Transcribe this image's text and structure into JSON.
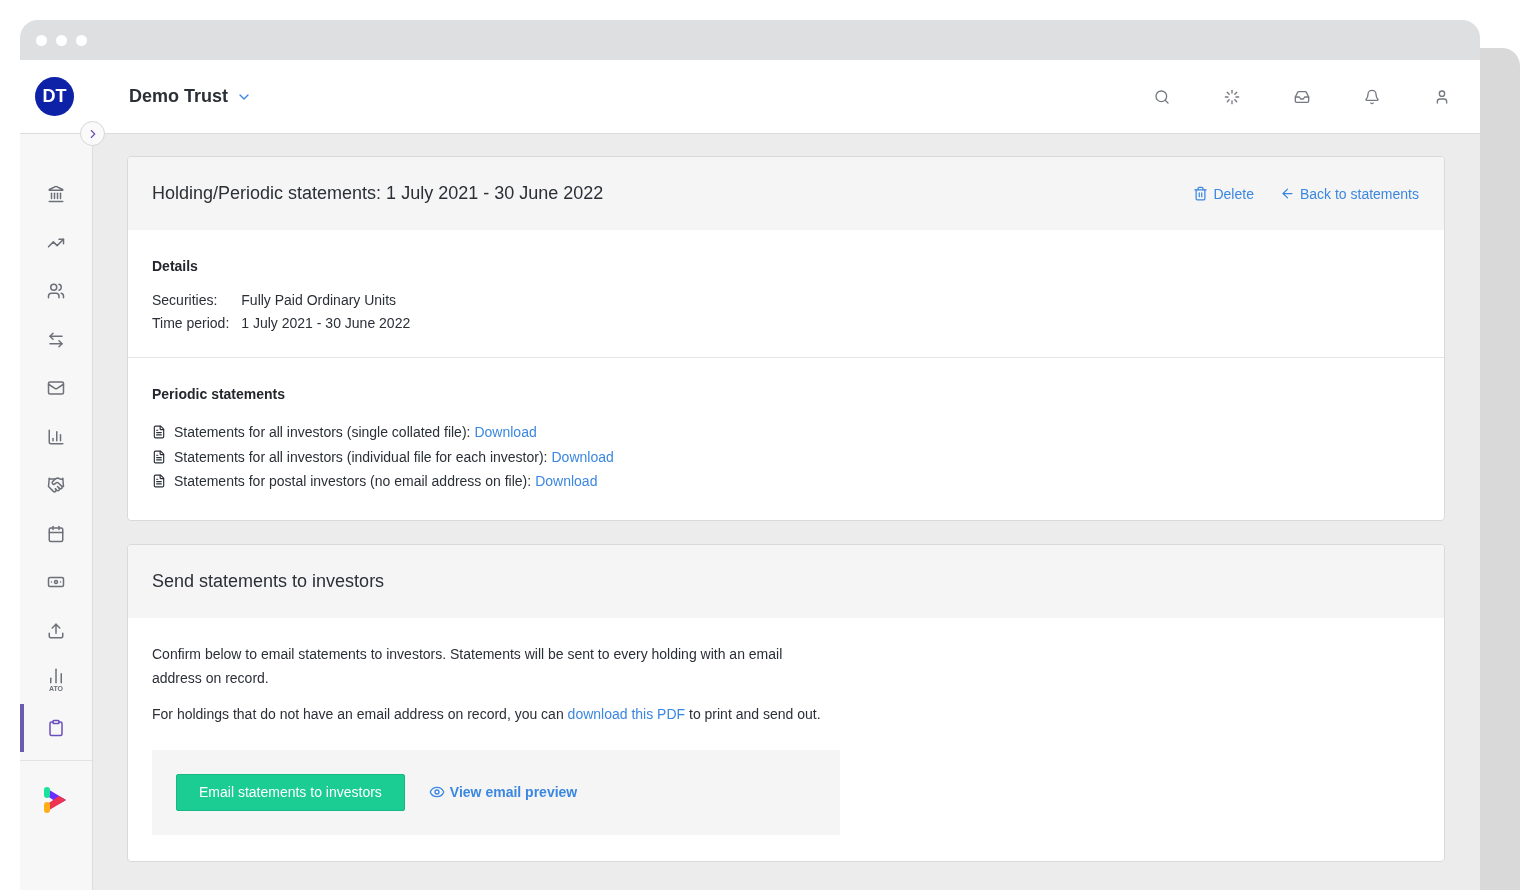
{
  "header": {
    "avatar": "DT",
    "account": "Demo Trust"
  },
  "sidebar": {
    "items": [
      {
        "kind": "bank",
        "selected": false
      },
      {
        "kind": "trend",
        "selected": false
      },
      {
        "kind": "users",
        "selected": false
      },
      {
        "kind": "transfer",
        "selected": false
      },
      {
        "kind": "mail",
        "selected": false
      },
      {
        "kind": "bars",
        "selected": false
      },
      {
        "kind": "handshake",
        "selected": false
      },
      {
        "kind": "calendar",
        "selected": false
      },
      {
        "kind": "money",
        "selected": false
      },
      {
        "kind": "upload",
        "selected": false
      },
      {
        "kind": "ato",
        "label": "ATO",
        "selected": false
      },
      {
        "kind": "clipboard",
        "selected": true
      }
    ]
  },
  "statement_card": {
    "title": "Holding/Periodic statements: 1 July 2021 - 30 June 2022",
    "actions": [
      {
        "kind": "delete",
        "label": "Delete"
      },
      {
        "kind": "back",
        "label": "Back to statements"
      }
    ],
    "details": {
      "heading": "Details",
      "rows": [
        {
          "label": "Securities:",
          "value": "Fully Paid Ordinary Units"
        },
        {
          "label": "Time period:",
          "value": "1 July 2021 - 30 June 2022"
        }
      ]
    },
    "periodic": {
      "heading": "Periodic statements",
      "files": [
        {
          "text": "Statements for all investors (single collated file):",
          "link": "Download"
        },
        {
          "text": "Statements for all investors (individual file for each investor):",
          "link": "Download"
        },
        {
          "text": "Statements for postal investors (no email address on file):",
          "link": "Download"
        }
      ]
    }
  },
  "send_card": {
    "title": "Send statements to investors",
    "paragraph": "Confirm below to email statements to investors. Statements will be sent to every holding with an email address on record.",
    "note": {
      "before": "For holdings that do not have an email address on record, you can",
      "link": "download this PDF",
      "after": "to print and send out."
    },
    "primary_button": "Email statements to investors",
    "preview_link": "View email preview"
  }
}
